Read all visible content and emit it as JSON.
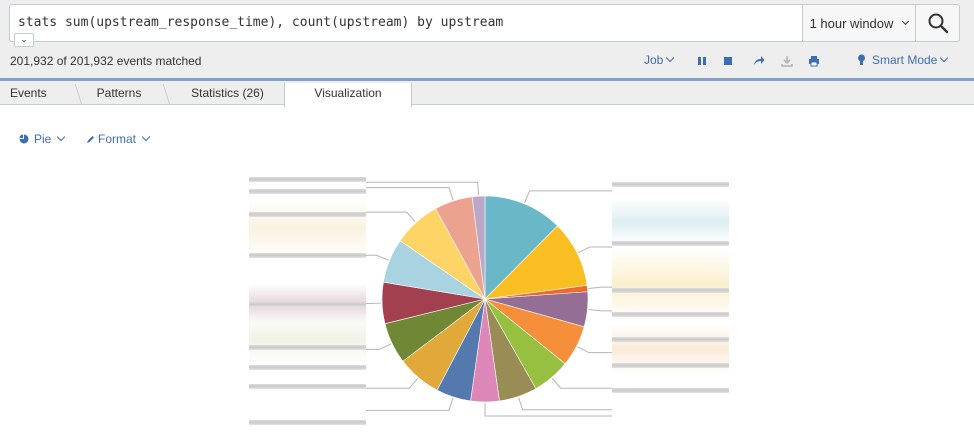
{
  "search": {
    "query": "stats sum(upstream_response_time), count(upstream) by upstream",
    "time_range": "1 hour window",
    "collapse_glyph": "⌄"
  },
  "status": {
    "events_matched": "201,932 of 201,932 events matched"
  },
  "job_bar": {
    "job_label": "Job",
    "mode_label": "Smart Mode",
    "icons": [
      "pause-icon",
      "stop-icon",
      "share-icon",
      "export-icon",
      "print-icon",
      "lightbulb-icon"
    ]
  },
  "tabs": [
    {
      "label": "Events",
      "active": false
    },
    {
      "label": "Patterns",
      "active": false
    },
    {
      "label": "Statistics (26)",
      "active": false
    },
    {
      "label": "Visualization",
      "active": true
    }
  ],
  "viz_controls": {
    "chart_type_label": "Pie",
    "format_label": "Format"
  },
  "chart_data": {
    "type": "pie",
    "note_labels": "slice labels are blurred/redacted in the screenshot",
    "slices": [
      {
        "value": 12.5,
        "color": "#6ab7c7"
      },
      {
        "value": 10.5,
        "color": "#f8be22"
      },
      {
        "value": 1.0,
        "color": "#ec6b2d"
      },
      {
        "value": 5.5,
        "color": "#956e96"
      },
      {
        "value": 6.5,
        "color": "#f58f39"
      },
      {
        "value": 6.0,
        "color": "#97bf40"
      },
      {
        "value": 6.0,
        "color": "#998c55"
      },
      {
        "value": 4.5,
        "color": "#dd87b8"
      },
      {
        "value": 5.5,
        "color": "#5479af"
      },
      {
        "value": 7.0,
        "color": "#e0a939"
      },
      {
        "value": 6.5,
        "color": "#708735"
      },
      {
        "value": 6.5,
        "color": "#a2404f"
      },
      {
        "value": 7.0,
        "color": "#a9d3e0"
      },
      {
        "value": 7.5,
        "color": "#fed466"
      },
      {
        "value": 6.0,
        "color": "#eba390"
      },
      {
        "value": 2.0,
        "color": "#bba7c6"
      }
    ]
  }
}
